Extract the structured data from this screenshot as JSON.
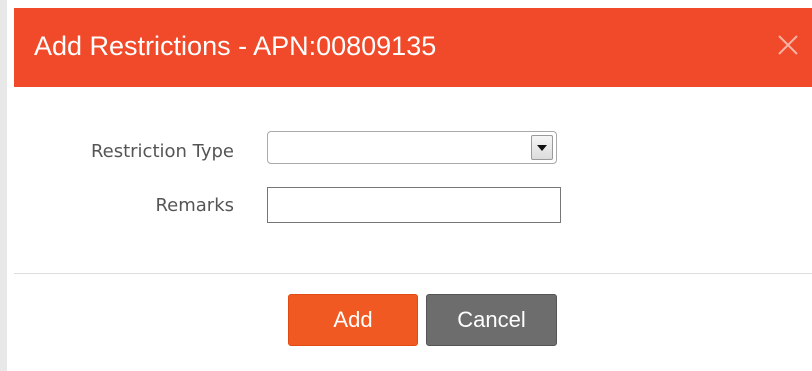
{
  "dialog": {
    "title": "Add Restrictions - APN:00809135",
    "close_icon": "close-icon"
  },
  "form": {
    "restriction_type": {
      "label": "Restriction Type",
      "selected_value": ""
    },
    "remarks": {
      "label": "Remarks",
      "value": "",
      "placeholder": ""
    }
  },
  "buttons": {
    "add_label": "Add",
    "cancel_label": "Cancel"
  },
  "colors": {
    "header": "#f04a2a",
    "add_button": "#f05a22",
    "cancel_button": "#6d6d6d"
  }
}
